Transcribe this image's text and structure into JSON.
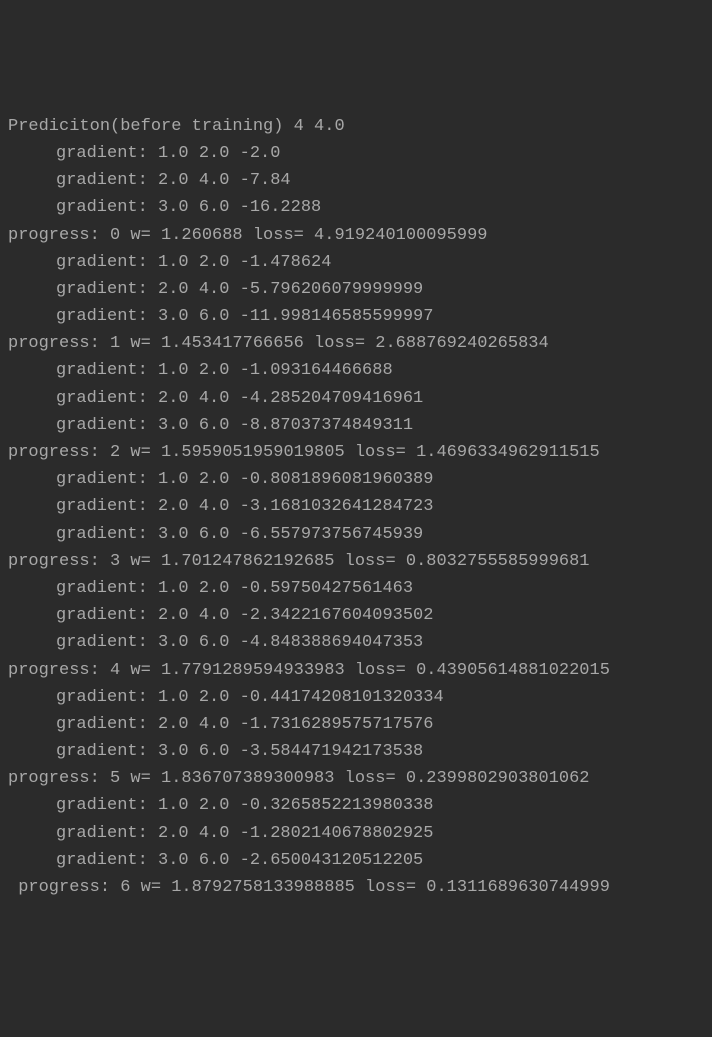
{
  "header": {
    "prefix": "Prediciton(before training)",
    "val1": "4",
    "val2": "4.0"
  },
  "initial_gradients": [
    {
      "x": "1.0",
      "y": "2.0",
      "g": "-2.0"
    },
    {
      "x": "2.0",
      "y": "4.0",
      "g": "-7.84"
    },
    {
      "x": "3.0",
      "y": "6.0",
      "g": "-16.2288"
    }
  ],
  "epochs": [
    {
      "n": "0",
      "w": "1.260688",
      "loss": "4.919240100095999",
      "gradients": [
        {
          "x": "1.0",
          "y": "2.0",
          "g": "-1.478624"
        },
        {
          "x": "2.0",
          "y": "4.0",
          "g": "-5.796206079999999"
        },
        {
          "x": "3.0",
          "y": "6.0",
          "g": "-11.998146585599997"
        }
      ]
    },
    {
      "n": "1",
      "w": "1.453417766656",
      "loss": "2.688769240265834",
      "gradients": [
        {
          "x": "1.0",
          "y": "2.0",
          "g": "-1.093164466688"
        },
        {
          "x": "2.0",
          "y": "4.0",
          "g": "-4.285204709416961"
        },
        {
          "x": "3.0",
          "y": "6.0",
          "g": "-8.87037374849311"
        }
      ]
    },
    {
      "n": "2",
      "w": "1.5959051959019805",
      "loss": "1.4696334962911515",
      "gradients": [
        {
          "x": "1.0",
          "y": "2.0",
          "g": "-0.8081896081960389"
        },
        {
          "x": "2.0",
          "y": "4.0",
          "g": "-3.1681032641284723"
        },
        {
          "x": "3.0",
          "y": "6.0",
          "g": "-6.557973756745939"
        }
      ]
    },
    {
      "n": "3",
      "w": "1.701247862192685",
      "loss": "0.8032755585999681",
      "gradients": [
        {
          "x": "1.0",
          "y": "2.0",
          "g": "-0.59750427561463"
        },
        {
          "x": "2.0",
          "y": "4.0",
          "g": "-2.3422167604093502"
        },
        {
          "x": "3.0",
          "y": "6.0",
          "g": "-4.848388694047353"
        }
      ]
    },
    {
      "n": "4",
      "w": "1.7791289594933983",
      "loss": "0.43905614881022015",
      "gradients": [
        {
          "x": "1.0",
          "y": "2.0",
          "g": "-0.44174208101320334"
        },
        {
          "x": "2.0",
          "y": "4.0",
          "g": "-1.7316289575717576"
        },
        {
          "x": "3.0",
          "y": "6.0",
          "g": "-3.584471942173538"
        }
      ]
    },
    {
      "n": "5",
      "w": "1.836707389300983",
      "loss": "0.2399802903801062",
      "gradients": [
        {
          "x": "1.0",
          "y": "2.0",
          "g": "-0.3265852213980338"
        },
        {
          "x": "2.0",
          "y": "4.0",
          "g": "-1.2802140678802925"
        },
        {
          "x": "3.0",
          "y": "6.0",
          "g": "-2.650043120512205"
        }
      ]
    },
    {
      "n": "6",
      "w": "1.8792758133988885",
      "loss": "0.1311689630744999",
      "gradients": []
    }
  ],
  "labels": {
    "gradient": "gradient:",
    "progress": "progress:",
    "w": "w=",
    "loss": "loss="
  }
}
